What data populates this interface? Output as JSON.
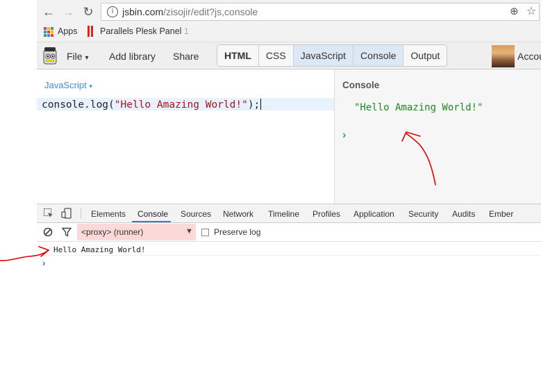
{
  "browser": {
    "nav": {
      "back_icon": "arrow-left-icon",
      "forward_icon": "arrow-right-icon",
      "reload_icon": "reload-icon"
    },
    "address": {
      "domain": "jsbin.com",
      "path": "/zisojir/edit?js,console"
    },
    "bookmarks": {
      "apps_label": "Apps",
      "plesk_label": "Parallels Plesk Panel",
      "plesk_badge": "1"
    }
  },
  "jsbin": {
    "menu": {
      "file": "File",
      "file_caret": "▾",
      "add_library": "Add library",
      "share": "Share"
    },
    "panels": [
      "HTML",
      "CSS",
      "JavaScript",
      "Console",
      "Output"
    ],
    "active_panels": [
      "JavaScript",
      "Console"
    ],
    "account": "Accou"
  },
  "editor": {
    "language": "JavaScript",
    "language_caret": "▾",
    "code": {
      "prefix": "console.log(",
      "string": "\"Hello Amazing World!\"",
      "suffix": ");"
    }
  },
  "console_panel": {
    "title": "Console",
    "output": "\"Hello Amazing World!\"",
    "prompt": "›"
  },
  "devtools": {
    "tabs": [
      "Elements",
      "Console",
      "Sources",
      "Network",
      "Timeline",
      "Profiles",
      "Application",
      "Security",
      "Audits",
      "Ember"
    ],
    "active_tab": "Console",
    "context": "<proxy> (runner)",
    "context_caret": "▼",
    "preserve_log": "Preserve log",
    "log_message": "Hello Amazing World!",
    "prompt": "›"
  },
  "colors": {
    "accent": "#3879d9",
    "annotation": "#e00000",
    "console_string": "#1e8a1e",
    "context_bg": "#fcd9d9"
  }
}
